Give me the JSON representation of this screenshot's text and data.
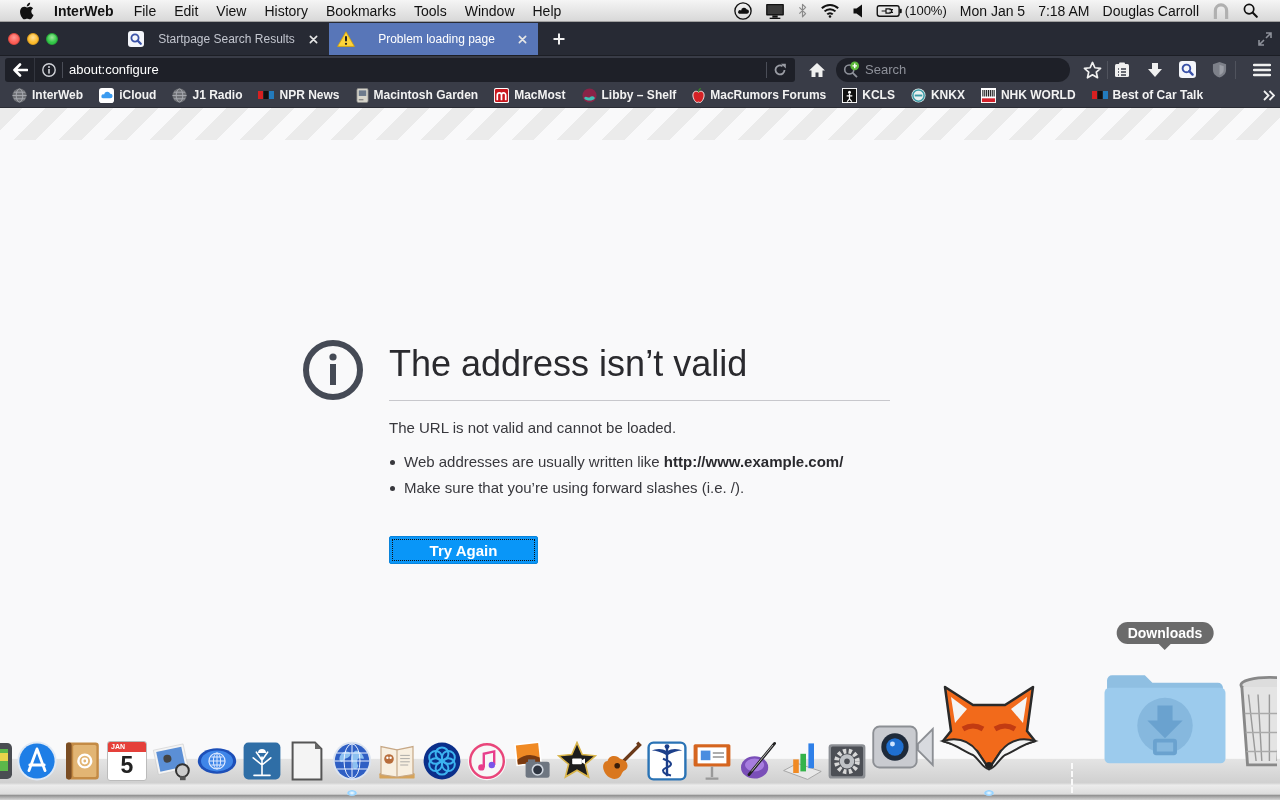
{
  "menu_bar": {
    "app_name": "InterWeb",
    "menus": [
      "File",
      "Edit",
      "View",
      "History",
      "Bookmarks",
      "Tools",
      "Window",
      "Help"
    ],
    "battery": "(100%)",
    "date": "Mon Jan 5",
    "time": "7:18 AM",
    "user": "Douglas Carroll"
  },
  "tabs": [
    {
      "title": "Startpage Search Results",
      "kind": "search",
      "selected": false
    },
    {
      "title": "Problem loading page",
      "kind": "warning",
      "selected": true
    }
  ],
  "toolbar": {
    "url": "about:configure",
    "search": {
      "placeholder": "Search"
    }
  },
  "bookmarks": {
    "items": [
      {
        "label": "InterWeb",
        "kind": "globe"
      },
      {
        "label": "iCloud",
        "kind": "cloud"
      },
      {
        "label": "J1 Radio",
        "kind": "globe"
      },
      {
        "label": "NPR News",
        "kind": "blocks"
      },
      {
        "label": "Macintosh Garden",
        "kind": "computer"
      },
      {
        "label": "MacMost",
        "kind": "arches"
      },
      {
        "label": "Libby – Shelf",
        "kind": "wave"
      },
      {
        "label": "MacRumors Forums",
        "kind": "apple"
      },
      {
        "label": "KCLS",
        "kind": "figure"
      },
      {
        "label": "KNKX",
        "kind": "ring"
      },
      {
        "label": "NHK WORLD",
        "kind": "stripes"
      },
      {
        "label": "Best of Car Talk",
        "kind": "blocks"
      }
    ]
  },
  "error": {
    "title": "The address isn’t valid",
    "description": "The URL is not valid and cannot be loaded.",
    "bullets": [
      "Web addresses are usually written like **http://www.example.com/**",
      "Make sure that you’re using forward slashes (i.e. /)."
    ],
    "button": {
      "label": "Try Again",
      "focused": true
    }
  },
  "dock": {
    "apps": [
      {
        "kind": "photo-tile",
        "running": false
      },
      {
        "kind": "letter-a",
        "running": false
      },
      {
        "kind": "address-book",
        "running": false
      },
      {
        "kind": "calendar",
        "month": "JAN",
        "day": "5",
        "running": false
      },
      {
        "kind": "photos-magnifier",
        "running": false
      },
      {
        "kind": "globe-oval",
        "running": false
      },
      {
        "kind": "thistle",
        "running": false
      },
      {
        "kind": "document",
        "running": false
      },
      {
        "kind": "globe",
        "running": true
      },
      {
        "kind": "book",
        "running": false
      },
      {
        "kind": "swirl",
        "running": false
      },
      {
        "kind": "music",
        "running": false
      },
      {
        "kind": "photo-camera",
        "running": false
      },
      {
        "kind": "star",
        "running": false
      },
      {
        "kind": "guitar",
        "running": false
      },
      {
        "kind": "caduceus",
        "running": false
      },
      {
        "kind": "presentation",
        "running": false
      },
      {
        "kind": "quill",
        "running": false
      },
      {
        "kind": "chart",
        "running": false
      },
      {
        "kind": "gear",
        "running": false
      },
      {
        "kind": "video-camera",
        "running": false
      },
      {
        "kind": "fox",
        "running": true
      }
    ],
    "stacks": [
      {
        "kind": "downloads",
        "tooltip": "Downloads"
      },
      {
        "kind": "trash"
      }
    ]
  }
}
